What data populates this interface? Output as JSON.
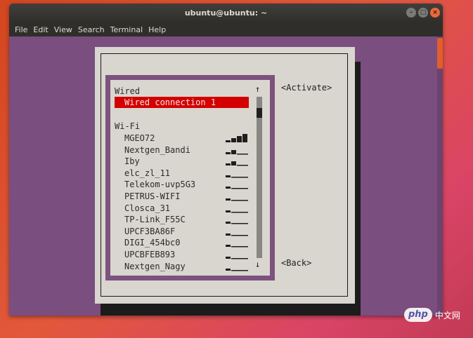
{
  "window": {
    "title": "ubuntu@ubuntu: ~",
    "buttons": {
      "minimize": "–",
      "maximize": "□",
      "close": "×"
    }
  },
  "menubar": [
    "File",
    "Edit",
    "View",
    "Search",
    "Terminal",
    "Help"
  ],
  "nmtui": {
    "wired_label": "Wired",
    "wired_connection": "Wired connection 1",
    "wifi_label": "Wi-Fi",
    "networks": [
      {
        "ssid": "MGEO72",
        "signal_bars": 4
      },
      {
        "ssid": "Nextgen_Bandi",
        "signal_bars": 2
      },
      {
        "ssid": "Iby",
        "signal_bars": 2
      },
      {
        "ssid": "elc_zl_11",
        "signal_bars": 1
      },
      {
        "ssid": "Telekom-uvp5G3",
        "signal_bars": 1
      },
      {
        "ssid": "PETRUS-WIFI",
        "signal_bars": 1
      },
      {
        "ssid": "Closca_31",
        "signal_bars": 1
      },
      {
        "ssid": "TP-Link_F55C",
        "signal_bars": 1
      },
      {
        "ssid": "UPCF3BA86F",
        "signal_bars": 1
      },
      {
        "ssid": "DIGI_454bc0",
        "signal_bars": 1
      },
      {
        "ssid": "UPCBFEB893",
        "signal_bars": 1
      },
      {
        "ssid": "Nextgen_Nagy",
        "signal_bars": 1
      }
    ],
    "scroll_up": "↑",
    "scroll_down": "↓",
    "activate_button": "<Activate>",
    "back_button": "<Back>"
  },
  "watermark": {
    "logo": "php",
    "text": "中文网"
  },
  "colors": {
    "terminal_bg": "#7a4e7e",
    "dialog_bg": "#d9d6cf",
    "selection": "#d40000",
    "accent": "#e05e2c"
  }
}
